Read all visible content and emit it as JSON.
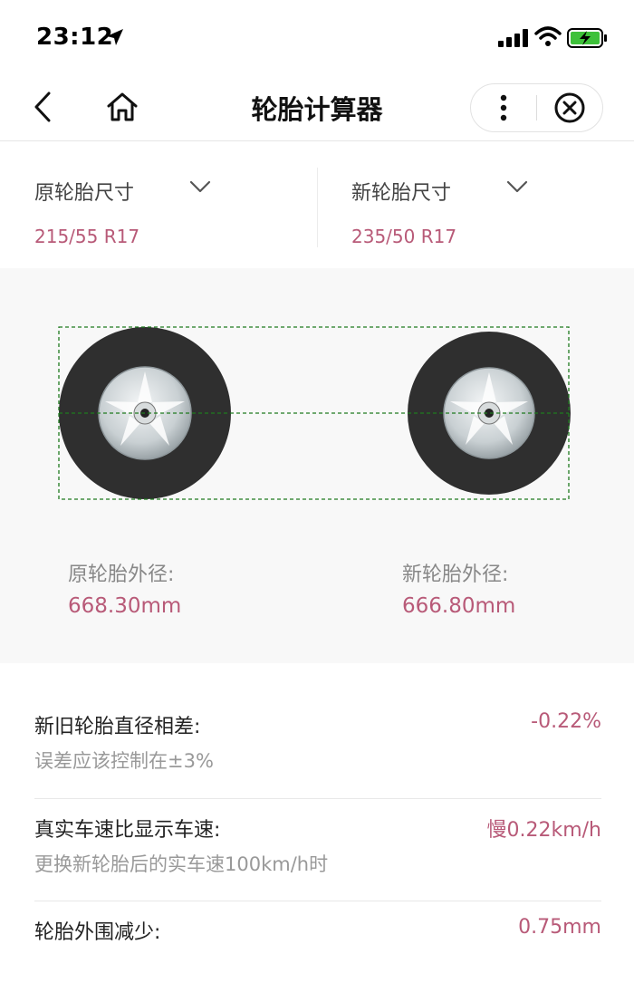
{
  "status_bar": {
    "time": "23:12",
    "icons": [
      "location-arrow-icon",
      "signal-icon",
      "wifi-icon",
      "battery-charging-icon"
    ],
    "battery_color": "#3ec13a"
  },
  "nav": {
    "title": "轮胎计算器",
    "icons": [
      "back-icon",
      "home-icon",
      "more-icon",
      "close-circle-icon"
    ]
  },
  "selectors": {
    "original": {
      "label": "原轮胎尺寸",
      "value": "215/55 R17"
    },
    "new": {
      "label": "新轮胎尺寸",
      "value": "235/50 R17"
    }
  },
  "diagram": {
    "original_label": "原轮胎外径:",
    "original_value": "668.30mm",
    "new_label": "新轮胎外径:",
    "new_value": "666.80mm",
    "guide_color": "#1f7a1f",
    "tire_color": "#2f2f2f"
  },
  "results": [
    {
      "title": "新旧轮胎直径相差:",
      "note": "误差应该控制在±3%",
      "value": "-0.22%"
    },
    {
      "title": "真实车速比显示车速:",
      "note": "更换新轮胎后的实车速100km/h时",
      "value": "慢0.22km/h"
    },
    {
      "title": "轮胎外围减少:",
      "value": "0.75mm"
    }
  ],
  "colors": {
    "accent": "#b85a78",
    "background_panel": "#f8f8f8"
  }
}
